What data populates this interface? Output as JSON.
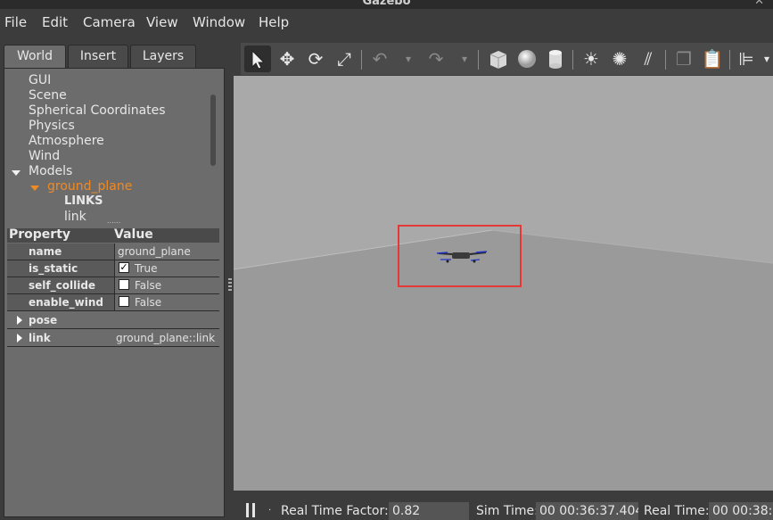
{
  "window": {
    "title": "Gazebo"
  },
  "menu": [
    "File",
    "Edit",
    "Camera",
    "View",
    "Window",
    "Help"
  ],
  "tabs": [
    "World",
    "Insert",
    "Layers"
  ],
  "tree": {
    "items": [
      "GUI",
      "Scene",
      "Spherical Coordinates",
      "Physics",
      "Atmosphere",
      "Wind"
    ],
    "models_label": "Models",
    "model_name": "ground_plane",
    "links_heading": "LINKS",
    "link_name": "link",
    "more": "......"
  },
  "properties": {
    "header_property": "Property",
    "header_value": "Value",
    "rows": [
      {
        "key": "name",
        "value": "ground_plane"
      },
      {
        "key": "is_static",
        "value": "True",
        "checked": true
      },
      {
        "key": "self_collide",
        "value": "False",
        "checked": false
      },
      {
        "key": "enable_wind",
        "value": "False",
        "checked": false
      }
    ],
    "pose_label": "pose",
    "link_label": "link",
    "link_value": "ground_plane::link"
  },
  "toolbar": {
    "icons": [
      "select-arrow-icon",
      "translate-icon",
      "rotate-icon",
      "scale-icon",
      "undo-icon",
      "redo-icon",
      "box-icon",
      "sphere-icon",
      "cylinder-icon",
      "point-light-icon",
      "spot-light-icon",
      "directional-light-icon",
      "copy-icon",
      "paste-icon",
      "align-icon"
    ]
  },
  "status": {
    "rtf_label": "Real Time Factor:",
    "rtf_value": "0.82",
    "sim_label": "Sim Time:",
    "sim_value": "00 00:36:37.404",
    "real_label": "Real Time:",
    "real_value": "00 00:38:4"
  },
  "colors": {
    "selection_box": "#e53935",
    "orange_selected": "#f08a24",
    "viewport_sky": "#a9a9a9",
    "ground": "#9a9a9a"
  }
}
